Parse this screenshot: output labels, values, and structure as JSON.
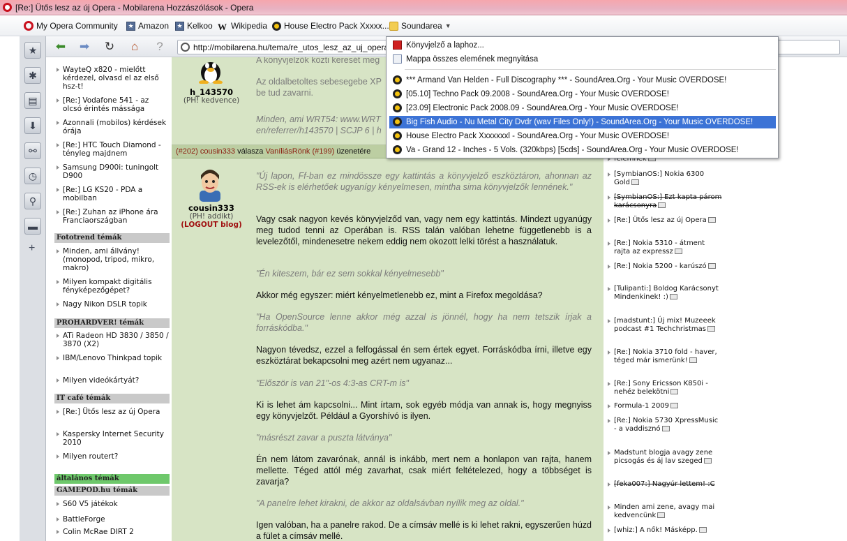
{
  "window": {
    "title": "[Re:] Ütős lesz az új Opera - Mobilarena Hozzászólások - Opera"
  },
  "bookmarks": {
    "items": [
      {
        "label": "My Opera Community",
        "icon": "opera-icon"
      },
      {
        "label": "Amazon",
        "icon": "bookmark-icon"
      },
      {
        "label": "Kelkoo",
        "icon": "bookmark-icon"
      },
      {
        "label": "Wikipedia",
        "icon": "wikipedia-icon"
      },
      {
        "label": "House Electro Pack Xxxxx...",
        "icon": "soundarea-icon"
      },
      {
        "label": "Soundarea",
        "icon": "folder-icon"
      }
    ]
  },
  "address": {
    "url": "http://mobilarena.hu/tema/re_utos_lesz_az_uj_opera"
  },
  "dropdown": {
    "top_items": [
      {
        "label": "Könyvjelző a laphoz..."
      },
      {
        "label": "Mappa összes elemének megnyitása"
      }
    ],
    "items": [
      {
        "label": "*** Armand Van Helden - Full Discography *** - SoundArea.Org - Your Music OVERDOSE!"
      },
      {
        "label": "[05.10] Techno Pack 09.2008 - SoundArea.Org - Your Music OVERDOSE!"
      },
      {
        "label": "[23.09] Electronic Pack 2008.09 - SoundArea.Org - Your Music OVERDOSE!"
      },
      {
        "label": "Big Fish Audio - Nu Metal City Dvdr (wav Files Only!) - SoundArea.Org - Your Music OVERDOSE!",
        "selected": true
      },
      {
        "label": "House Electro Pack Xxxxxxxl - SoundArea.Org - Your Music OVERDOSE!"
      },
      {
        "label": "Va - Grand 12 - Inches - 5 Vols. (320kbps) [5cds] - SoundArea.Org - Your Music OVERDOSE!"
      }
    ]
  },
  "leftcol": {
    "items1": [
      "WayteQ x820 - mielőtt kérdezel, olvasd el az első hsz-t!",
      "[Re:] Vodafone 541 - az olcsó érintés mássága",
      "Azonnali (mobilos) kérdések órája",
      "[Re:] HTC Touch Diamond - tényleg majdnem",
      "Samsung D900i: tuningolt D900",
      "[Re:] LG KS20 - PDA a mobilban",
      "[Re:] Zuhan az iPhone ára Franciaországban"
    ],
    "section_fototrend": "Fototrend témák",
    "items2": [
      "Minden, ami állvány! (monopod, tripod, mikro, makro)",
      "Milyen kompakt digitális fényképezőgépet?",
      "Nagy Nikon DSLR topik"
    ],
    "section_prohardver": "PROHARDVER! témák",
    "items3": [
      "ATi Radeon HD 3830 / 3850 / 3870 (X2)",
      "IBM/Lenovo Thinkpad topik",
      "Milyen videókártyát?"
    ],
    "section_itcafe": "IT café témák",
    "items4": [
      "[Re:] Ütős lesz az új Opera",
      "Kaspersky Internet Security 2010",
      "Milyen routert?"
    ],
    "section_altalanos": "általános témák",
    "section_gamepod": "GAMEPOD.hu témák",
    "items5": [
      "S60 V5 játékok",
      "BattleForge",
      "Colin McRae DIRT 2"
    ]
  },
  "post1": {
    "top_text": "A könyvjelzők közti keresét meg",
    "user": "h_143570",
    "user_status": "(PH! kedvence)",
    "text1": "Az oldalbetoltes sebesegebe XP",
    "text1b": "be tud zavarni.",
    "sig1": "Minden, ami WRT54: www.WRT",
    "sig2": "en/referrer/h143570 | SCJP 6 | h"
  },
  "post2": {
    "header": {
      "num": "(#202)",
      "author": "cousin333",
      "mid": "válasza",
      "target": "VaníliásRönk",
      "target_num": "(#199)",
      "end": "üzenetére"
    },
    "user": "cousin333",
    "user_status": "(PH! addikt)",
    "user_blog": "(LOGOUT blog)",
    "paragraphs": [
      {
        "quote": true,
        "text": "\"Új lapon, Ff-ban ez mindössze egy kattintás a könyvjelző eszköztáron, ahonnan az RSS-ek is elérhetőek ugyanígy kényelmesen, mintha sima könyvjelzők lennének.\""
      },
      {
        "quote": false,
        "text": "Vagy csak nagyon kevés könyvjelződ van, vagy nem egy kattintás. Mindezt ugyanúgy meg tudod tenni az Operában is. RSS talán valóban lehetne függetlenebb is a levelezőtől, mindenesetre nekem eddig nem okozott lelki törést a használatuk."
      },
      {
        "quote": true,
        "text": "\"Én kiteszem, bár ez sem sokkal kényelmesebb\""
      },
      {
        "quote": false,
        "text": "Akkor még egyszer: miért kényelmetlenebb ez, mint a Firefox megoldása?"
      },
      {
        "quote": true,
        "text": "\"Ha OpenSource lenne akkor még azzal is jönnél, hogy ha nem tetszik írjak a forráskódba.\""
      },
      {
        "quote": false,
        "text": "Nagyon tévedsz, ezzel a felfogással én sem értek egyet. Forráskódba írni, illetve egy eszköztárat bekapcsolni meg azért nem ugyanaz..."
      },
      {
        "quote": true,
        "text": "\"Először is van 21\"-os 4:3-as CRT-m is\""
      },
      {
        "quote": false,
        "text": "Ki is lehet ám kapcsolni... Mint írtam, sok egyéb módja van annak is, hogy megnyiss egy könyvjelzőt. Például a Gyorshívó is ilyen."
      },
      {
        "quote": true,
        "text": "\"másrészt zavar a puszta látványa\""
      },
      {
        "quote": false,
        "text": "Én nem látom zavarónak, annál is inkább, mert nem a honlapon van rajta, hanem mellette. Téged attól még zavarhat, csak miért feltételezed, hogy a többséget is zavarja?"
      },
      {
        "quote": true,
        "text": "\"A panelre lehet kirakni, de akkor az oldalsávban nyílik meg az oldal.\""
      },
      {
        "quote": false,
        "text": "Igen valóban, ha a panelre rakod. De a címsáv mellé is ki lehet rakni, egyszerűen húzd a fület a címsáv mellé."
      }
    ]
  },
  "rightcol": {
    "items": [
      {
        "text": "felemnek",
        "strike": false
      },
      {
        "text": "[SymbianOS:] Nokia 6300 Gold",
        "strike": false
      },
      {
        "text": "[SymbianOS:] Ezt kapta párom karácsonyra",
        "strike": true
      },
      {
        "text": "[Re:] Ütős lesz az új Opera",
        "strike": false
      },
      {
        "text": "[Re:] Nokia 5310 - átment rajta az expressz",
        "strike": false
      },
      {
        "text": "[Re:] Nokia 5200 - karúszó",
        "strike": false
      },
      {
        "text": "[Tulipanti:] Boldog Karácsonyt Mindenkinek! :)",
        "strike": false
      },
      {
        "text": "[madstunt:] Új mix! Muzeeek podcast #1 Techchristmas",
        "strike": false
      },
      {
        "text": "[Re:] Nokia 3710 fold - haver, téged már ismerünk!",
        "strike": false
      },
      {
        "text": "[Re:] Sony Ericsson K850i - nehéz belekötni",
        "strike": false
      },
      {
        "text": "Formula-1 2009",
        "strike": false
      },
      {
        "text": "[Re:] Nokia 5730 XpressMusic - a vaddisznó",
        "strike": false
      },
      {
        "text": "Madstunt blogja avagy zene picsogás és áj lav szeged",
        "strike": false
      },
      {
        "text": "[feka007:] Nagyúr lettem! :C",
        "strike": true
      },
      {
        "text": "Minden ami zene, avagy mai kedvencünk",
        "strike": false
      },
      {
        "text": "[whiz:] A nők! Másképp.",
        "strike": false
      }
    ]
  }
}
